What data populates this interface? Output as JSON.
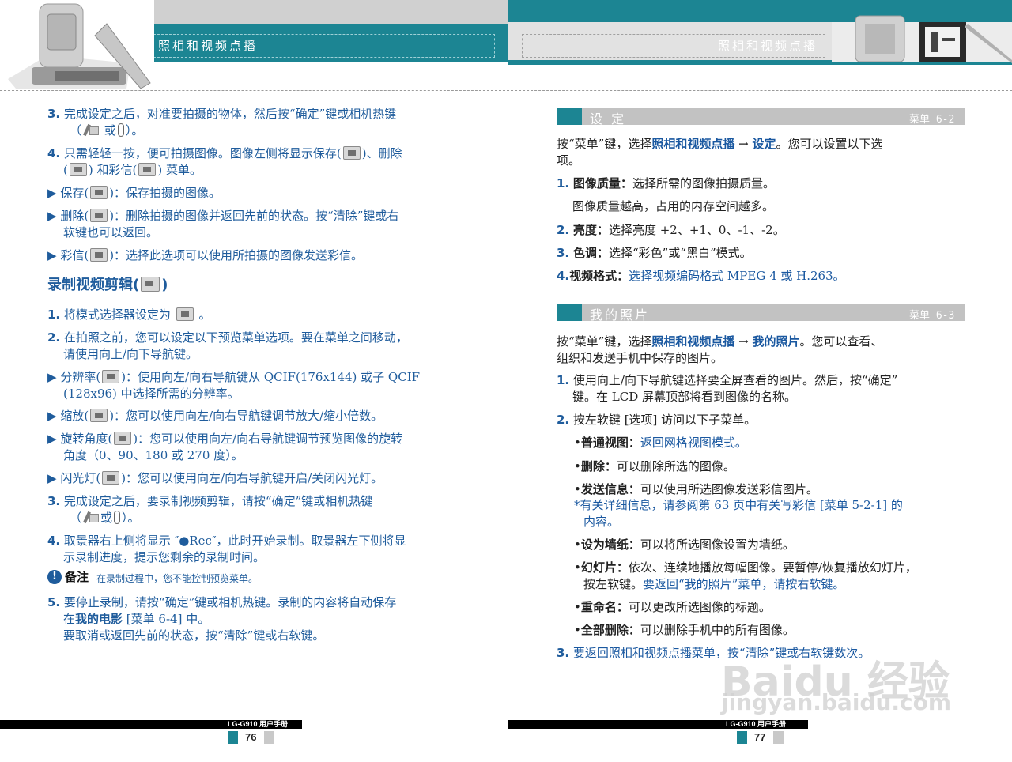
{
  "header": {
    "left_title": "照相和视频点播",
    "right_title": "照相和视频点播"
  },
  "left": {
    "s3_l1": "完成设定之后，对准要拍摄的物体，然后按“确定”键或相机热键",
    "s3_l2a": "（",
    "s3_l2b": "或",
    "s3_l2c": "）。",
    "s4_l1a": "只需轻轻一按，便可拍摄图像。图像左侧将显示保存(",
    "s4_l1b": ")、删除",
    "s4_l2a": "(",
    "s4_l2b": ") 和彩信(",
    "s4_l2c": ") 菜单。",
    "save_a": "保存(",
    "save_b": ")：保存拍摄的图像。",
    "del_a": "删除(",
    "del_b": ")：删除拍摄的图像并返回先前的状态。按“清除”键或右",
    "del_l2": "软键也可以返回。",
    "mms_a": "彩信(",
    "mms_b": ")：选择此选项可以使用所拍摄的图像发送彩信。",
    "video_heading_a": "录制视频剪辑(",
    "video_heading_b": ")",
    "v1a": "将模式选择器设定为",
    "v1b": "。",
    "v2_l1": "在拍照之前，您可以设定以下预览菜单选项。要在菜单之间移动，",
    "v2_l2": "请使用向上/向下导航键。",
    "res_a": "分辨率(",
    "res_b": ")：使用向左/向右导航键从 QCIF(176x144) 或子 QCIF",
    "res_l2": "(128x96) 中选择所需的分辨率。",
    "zoom_a": "缩放(",
    "zoom_b": ")：您可以使用向左/向右导航键调节放大/缩小倍数。",
    "rot_a": "旋转角度(",
    "rot_b": ")：您可以使用向左/向右导航键调节预览图像的旋转",
    "rot_l2": "角度（0、90、180 或 270 度）。",
    "flash_a": "闪光灯(",
    "flash_b": ")：您可以使用向左/向右导航键开启/关闭闪光灯。",
    "v3_l1": "完成设定之后，要录制视频剪辑，请按“确定”键或相机热键",
    "v3_l2a": "（",
    "v3_l2b": "或",
    "v3_l2c": "）。",
    "v4_l1": "取景器右上侧将显示 ″●Rec″，此时开始录制。取景器左下侧将显",
    "v4_l2": "示录制进度，提示您剩余的录制时间。",
    "note_label": "备注",
    "note_text": "在录制过程中，您不能控制预览菜单。",
    "v5_l1": "要停止录制，请按“确定”键或相机热键。录制的内容将自动保存",
    "v5_l2a": "在",
    "v5_l2b": "我的电影",
    "v5_l2c": " [菜单 6-4] 中。",
    "v5_l3": "要取消或返回先前的状态，按“清除”键或右软键。",
    "nums": {
      "n3": "3.",
      "n4": "4.",
      "n1": "1.",
      "n2": "2.",
      "n3b": "3.",
      "n4b": "4.",
      "n5": "5.",
      "arrow": "▶"
    }
  },
  "right": {
    "settings_title": "设 定",
    "settings_menu": "菜单 6-2",
    "set_intro_a": "按“菜单”键，选择",
    "set_intro_b": "照相和视频点播",
    "set_intro_c": " → ",
    "set_intro_d": "设定",
    "set_intro_e": "。您可以设置以下选",
    "set_intro_l2": "项。",
    "q_label": "图像质量：",
    "q_text": "选择所需的图像拍摄质量。",
    "q_l2": "图像质量越高，占用的内存空间越多。",
    "br_label": "亮度：",
    "br_text": "选择亮度 +2、+1、0、-1、-2。",
    "ct_label": "色调：",
    "ct_text": "选择“彩色”或“黑白”模式。",
    "vf_label": "视频格式：",
    "vf_text": "选择视频编码格式 MPEG 4 或 H.263。",
    "photos_title": "我的照片",
    "photos_menu": "菜单 6-3",
    "ph_intro_a": "按“菜单”键，选择",
    "ph_intro_b": "照相和视频点播",
    "ph_intro_c": " → ",
    "ph_intro_d": "我的照片",
    "ph_intro_e": "。您可以查看、",
    "ph_intro_l2": "组织和发送手机中保存的图片。",
    "p1_l1": "使用向上/向下导航键选择要全屏查看的图片。然后，按“确定”",
    "p1_l2": "键。在 LCD 屏幕顶部将看到图像的名称。",
    "p2": "按左软键 [选项] 访问以下子菜单。",
    "b_normal_label": "普通视图：",
    "b_normal_text": "返回网格视图模式。",
    "b_delete_label": "删除：",
    "b_delete_text": "可以删除所选的图像。",
    "b_send_label": "发送信息：",
    "b_send_text": "可以使用所选图像发送彩信图片。",
    "b_send_note_l1": "有关详细信息，请参阅第 63 页中有关写彩信 [菜单 5-2-1] 的",
    "b_send_note_l2": "内容。",
    "b_wall_label": "设为墙纸：",
    "b_wall_text": "可以将所选图像设置为墙纸。",
    "b_slide_label": "幻灯片：",
    "b_slide_text": "依次、连续地播放每幅图像。要暂停/恢复播放幻灯片，",
    "b_slide_l2a": "按左软键。",
    "b_slide_l2b": "要返回“我的照片”菜单，请按右软键。",
    "b_rename_label": "重命名：",
    "b_rename_text": "可以更改所选图像的标题。",
    "b_delall_label": "全部删除：",
    "b_delall_text": "可以删除手机中的所有图像。",
    "p3": "要返回照相和视频点播菜单，按“清除”键或右软键数次。",
    "nums": {
      "n1": "1.",
      "n2": "2.",
      "n3": "3.",
      "n4": "4.",
      "p1": "1.",
      "p2": "2.",
      "p3": "3.",
      "bullet": "•",
      "star": "*"
    }
  },
  "footer": {
    "left_label": "LG-G910 用户手册",
    "left_page": "76",
    "right_label": "LG-G910 用户手册",
    "right_page": "77"
  },
  "watermark": {
    "logo": "Baidu 经验",
    "url": "jingyan.baidu.com"
  },
  "colors": {
    "teal": "#1c8593",
    "blue_text": "#1f5c9c",
    "grey": "#c9c9c9"
  }
}
